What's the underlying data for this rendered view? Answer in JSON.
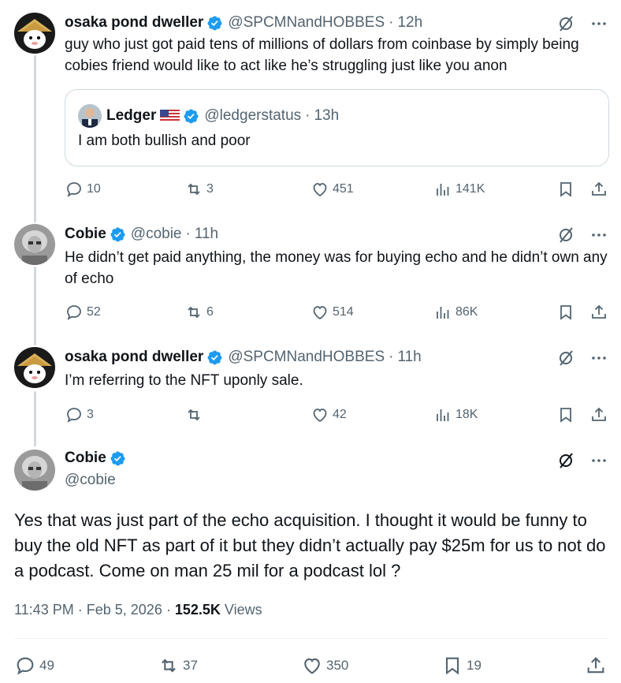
{
  "thread": [
    {
      "name": "osaka pond dweller",
      "handle": "@SPCMNandHOBBES",
      "time": "12h",
      "text": "guy who just got paid tens of millions of dollars from coinbase by simply being cobies friend would like to act like he’s struggling just like you anon",
      "quote": {
        "name": "Ledger",
        "handle": "@ledgerstatus",
        "time": "13h",
        "text": "I am both bullish and poor"
      },
      "replies": "10",
      "reposts": "3",
      "likes": "451",
      "views": "141K"
    },
    {
      "name": "Cobie",
      "handle": "@cobie",
      "time": "11h",
      "text": "He didn’t get paid anything, the money was for buying echo and he didn’t own any of echo",
      "replies": "52",
      "reposts": "6",
      "likes": "514",
      "views": "86K"
    },
    {
      "name": "osaka pond dweller",
      "handle": "@SPCMNandHOBBES",
      "time": "11h",
      "text": "I’m referring to the NFT uponly sale.",
      "replies": "3",
      "reposts": "",
      "likes": "42",
      "views": "18K"
    }
  ],
  "main": {
    "name": "Cobie",
    "handle": "@cobie",
    "text": "Yes that was just part of the echo acquisition. I thought it would be funny to buy the old NFT as part of it but they didn’t actually pay $25m for us to not do a podcast. Come on man 25 mil for a podcast lol ?",
    "time": "11:43 PM",
    "date": "Feb 5, 2026",
    "views_count": "152.5K",
    "views_label": "Views",
    "replies": "49",
    "reposts": "37",
    "likes": "350",
    "bookmarks": "19"
  },
  "separator": "·",
  "icons": {
    "verified": "verified-badge-icon",
    "grok": "grok-icon",
    "more": "more-icon",
    "reply": "reply-icon",
    "repost": "repost-icon",
    "like": "heart-icon",
    "views": "views-icon",
    "bookmark": "bookmark-icon",
    "share": "share-icon",
    "flag": "us-flag-icon"
  },
  "colors": {
    "text": "#0f1419",
    "secondary": "#536471",
    "verified": "#1d9bf0",
    "border": "#cfd9de"
  }
}
